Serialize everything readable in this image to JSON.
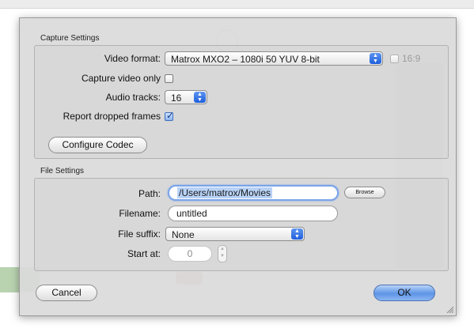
{
  "capture_settings": {
    "title": "Capture Settings",
    "video_format": {
      "label": "Video format:",
      "value": "Matrox MXO2 – 1080i 50 YUV 8-bit"
    },
    "aspect": {
      "label": "16:9",
      "checked": false
    },
    "capture_video_only": {
      "label": "Capture video only",
      "checked": false
    },
    "audio_tracks": {
      "label": "Audio tracks:",
      "value": "16"
    },
    "report_dropped_frames": {
      "label": "Report dropped frames",
      "checked": true
    },
    "configure_codec_label": "Configure Codec"
  },
  "file_settings": {
    "title": "File Settings",
    "path": {
      "label": "Path:",
      "value": "/Users/matrox/Movies"
    },
    "browse_label": "Browse",
    "filename": {
      "label": "Filename:",
      "value": "untitled"
    },
    "file_suffix": {
      "label": "File suffix:",
      "value": "None"
    },
    "start_at": {
      "label": "Start at:",
      "value": "0"
    }
  },
  "footer": {
    "cancel_label": "Cancel",
    "ok_label": "OK"
  },
  "colors": {
    "default_button": "#5d95e6",
    "focus_ring": "#7aa4e8",
    "sheet_bg": "#dadada"
  }
}
